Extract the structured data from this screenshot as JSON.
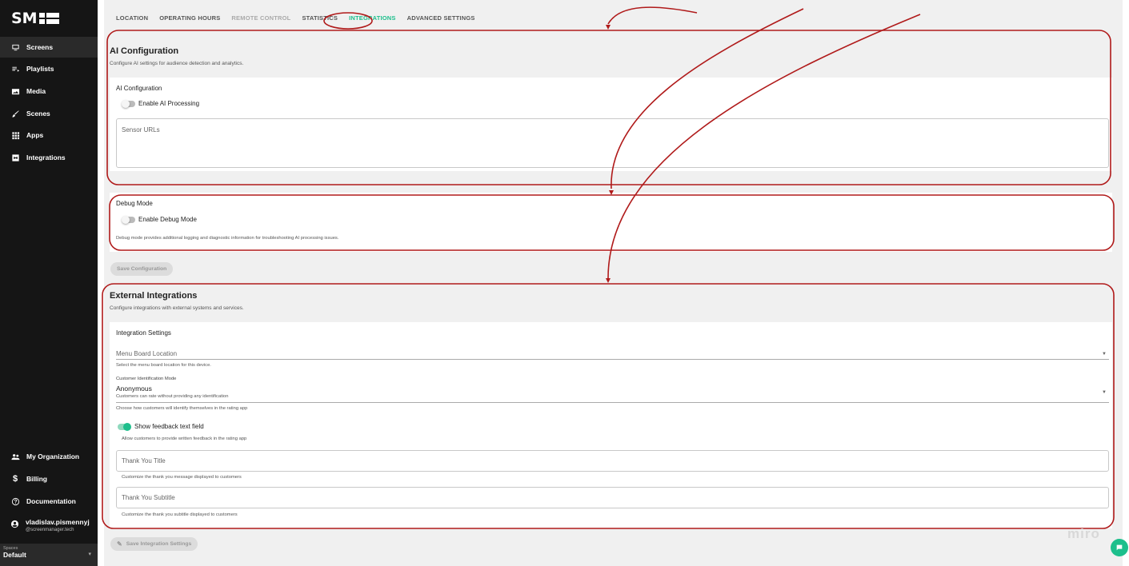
{
  "brand": {
    "logo_text": "SM"
  },
  "colors": {
    "accent": "#1dbf8c",
    "annotation": "#b01a1a",
    "sidebar_bg": "#151515"
  },
  "sidebar": {
    "items": [
      {
        "label": "Screens",
        "icon": "monitor-icon",
        "active": true
      },
      {
        "label": "Playlists",
        "icon": "playlist-icon"
      },
      {
        "label": "Media",
        "icon": "image-icon"
      },
      {
        "label": "Scenes",
        "icon": "brush-icon"
      },
      {
        "label": "Apps",
        "icon": "grid-icon"
      },
      {
        "label": "Integrations",
        "icon": "plug-icon"
      }
    ],
    "bottom_items": [
      {
        "label": "My Organization",
        "icon": "group-icon"
      },
      {
        "label": "Billing",
        "icon": "dollar-icon"
      },
      {
        "label": "Documentation",
        "icon": "help-icon"
      }
    ],
    "user": {
      "name": "vladislav.pismennyj",
      "email": "@screenmanager.tech",
      "icon": "account-icon"
    },
    "spaces": {
      "label": "Spaces",
      "value": "Default"
    }
  },
  "tabs": [
    {
      "label": "LOCATION"
    },
    {
      "label": "OPERATING HOURS"
    },
    {
      "label": "REMOTE CONTROL",
      "disabled": true
    },
    {
      "label": "STATISTICS"
    },
    {
      "label": "INTEGRATIONS",
      "active": true
    },
    {
      "label": "ADVANCED SETTINGS"
    }
  ],
  "ai": {
    "title": "AI Configuration",
    "description": "Configure AI settings for audience detection and analytics.",
    "card_title": "AI Configuration",
    "toggle_label": "Enable AI Processing",
    "toggle_on": false,
    "sensor_placeholder": "Sensor URLs"
  },
  "debug": {
    "card_title": "Debug Mode",
    "toggle_label": "Enable Debug Mode",
    "toggle_on": false,
    "helper": "Debug mode provides additional logging and diagnostic information for troubleshooting AI processing issues."
  },
  "save_config_label": "Save Configuration",
  "external": {
    "title": "External Integrations",
    "description": "Configure integrations with external systems and services.",
    "card_title": "Integration Settings",
    "menu_board_placeholder": "Menu Board Location",
    "menu_board_helper": "Select the menu board location for this device.",
    "customer_mode_label": "Customer Identification Mode",
    "customer_mode_value": "Anonymous",
    "customer_mode_subtext": "Customers can rate without providing any identification",
    "customer_mode_helper": "Choose how customers will identify themselves in the rating app",
    "feedback_toggle_label": "Show feedback text field",
    "feedback_toggle_on": true,
    "feedback_helper": "Allow customers to provide written feedback in the rating app",
    "thank_title_placeholder": "Thank You Title",
    "thank_title_helper": "Customize the thank you message displayed to customers",
    "thank_subtitle_placeholder": "Thank You Subtitle",
    "thank_subtitle_helper": "Customize the thank you subtitle displayed to customers"
  },
  "save_integration_label": "Save Integration Settings",
  "watermark": "miro"
}
